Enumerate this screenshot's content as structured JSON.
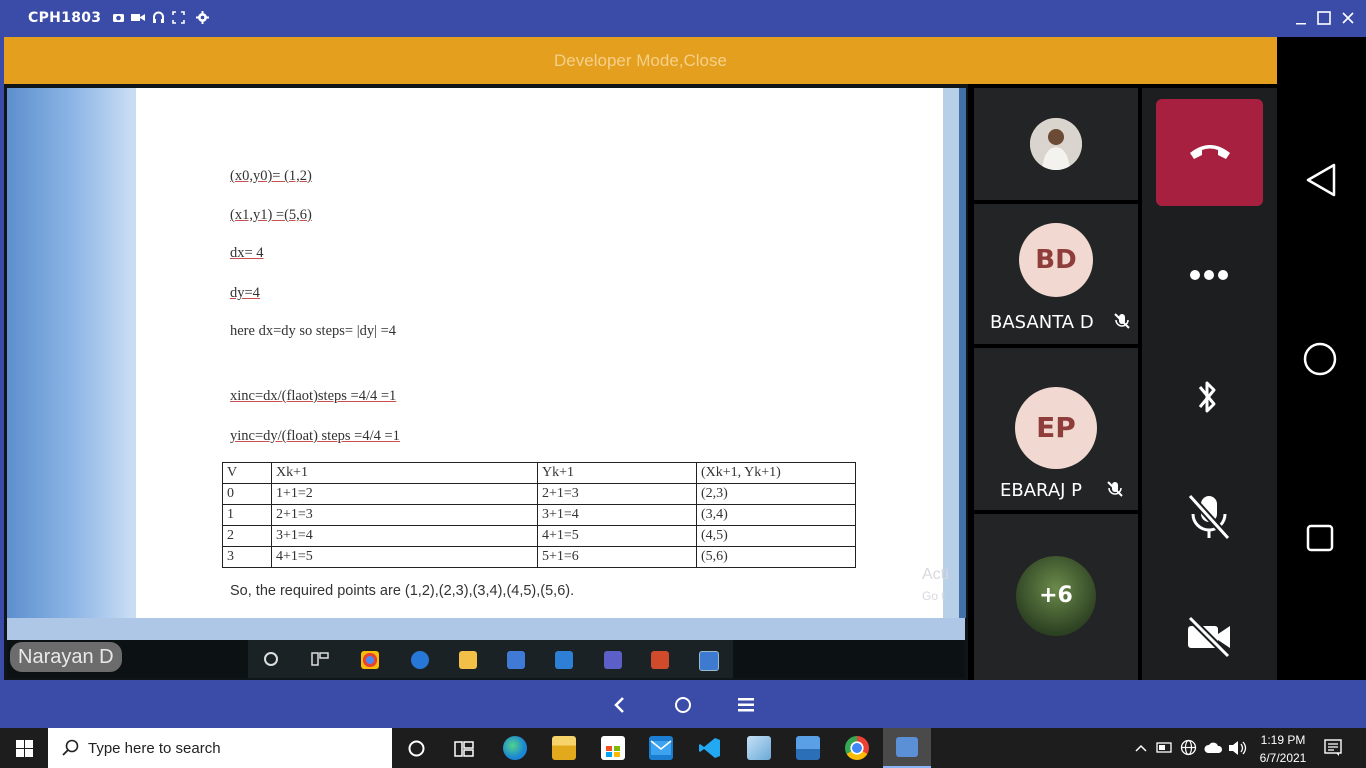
{
  "window": {
    "title": "CPH1803",
    "title_icons": [
      "camera-icon",
      "video-icon",
      "headphones-icon",
      "fullscreen-icon",
      "settings-icon"
    ],
    "controls": [
      "minimize-icon",
      "maximize-icon",
      "close-icon"
    ]
  },
  "dev_bar": {
    "label": "Developer Mode,Close"
  },
  "slide": {
    "lines": [
      "(x0,y0)= (1,2)",
      "(x1,y1) =(5,6)",
      "dx= 4",
      "dy=4",
      "here dx=dy so steps=  |dy| =4",
      "xinc=dx/(flaot)steps =4/4 =1",
      "yinc=dy/(float) steps =4/4 =1"
    ],
    "table": {
      "headers": [
        "V",
        "Xk+1",
        "Yk+1",
        "(Xk+1, Yk+1)"
      ],
      "rows": [
        [
          "0",
          "1+1=2",
          "2+1=3",
          "(2,3)"
        ],
        [
          "1",
          "2+1=3",
          "3+1=4",
          "(3,4)"
        ],
        [
          "2",
          "3+1=4",
          "4+1=5",
          "(4,5)"
        ],
        [
          "3",
          "4+1=5",
          "5+1=6",
          "(5,6)"
        ]
      ]
    },
    "conclusion": "So, the required points are (1,2),(2,3),(3,4),(4,5),(5,6).",
    "watermark": "Acti",
    "watermark2": "Go t"
  },
  "presenter": {
    "name": "Narayan D"
  },
  "participants": [
    {
      "initials": "",
      "name": "",
      "avatar_type": "photo"
    },
    {
      "initials": "BD",
      "name": "BASANTA D",
      "muted": true
    },
    {
      "initials": "EP",
      "name": "EBARAJ P",
      "muted": true
    },
    {
      "initials": "+6",
      "name": "",
      "avatar_type": "photo"
    }
  ],
  "call_controls": [
    "end-call-icon",
    "more-icon",
    "bluetooth-icon",
    "mic-off-icon",
    "camera-off-icon"
  ],
  "android_nav": [
    "back-icon",
    "home-icon",
    "recents-icon"
  ],
  "bottom_nav": [
    "back-chevron-icon",
    "home-circle-icon",
    "menu-icon"
  ],
  "taskbar": {
    "search_placeholder": "Type here to search",
    "time": "1:19 PM",
    "date": "6/7/2021"
  },
  "colors": {
    "frame_blue": "#3b4ba8",
    "dev_bar": "#e39f1d",
    "end_call": "#a8203f",
    "avatar_bg": "#f1d9d2"
  }
}
